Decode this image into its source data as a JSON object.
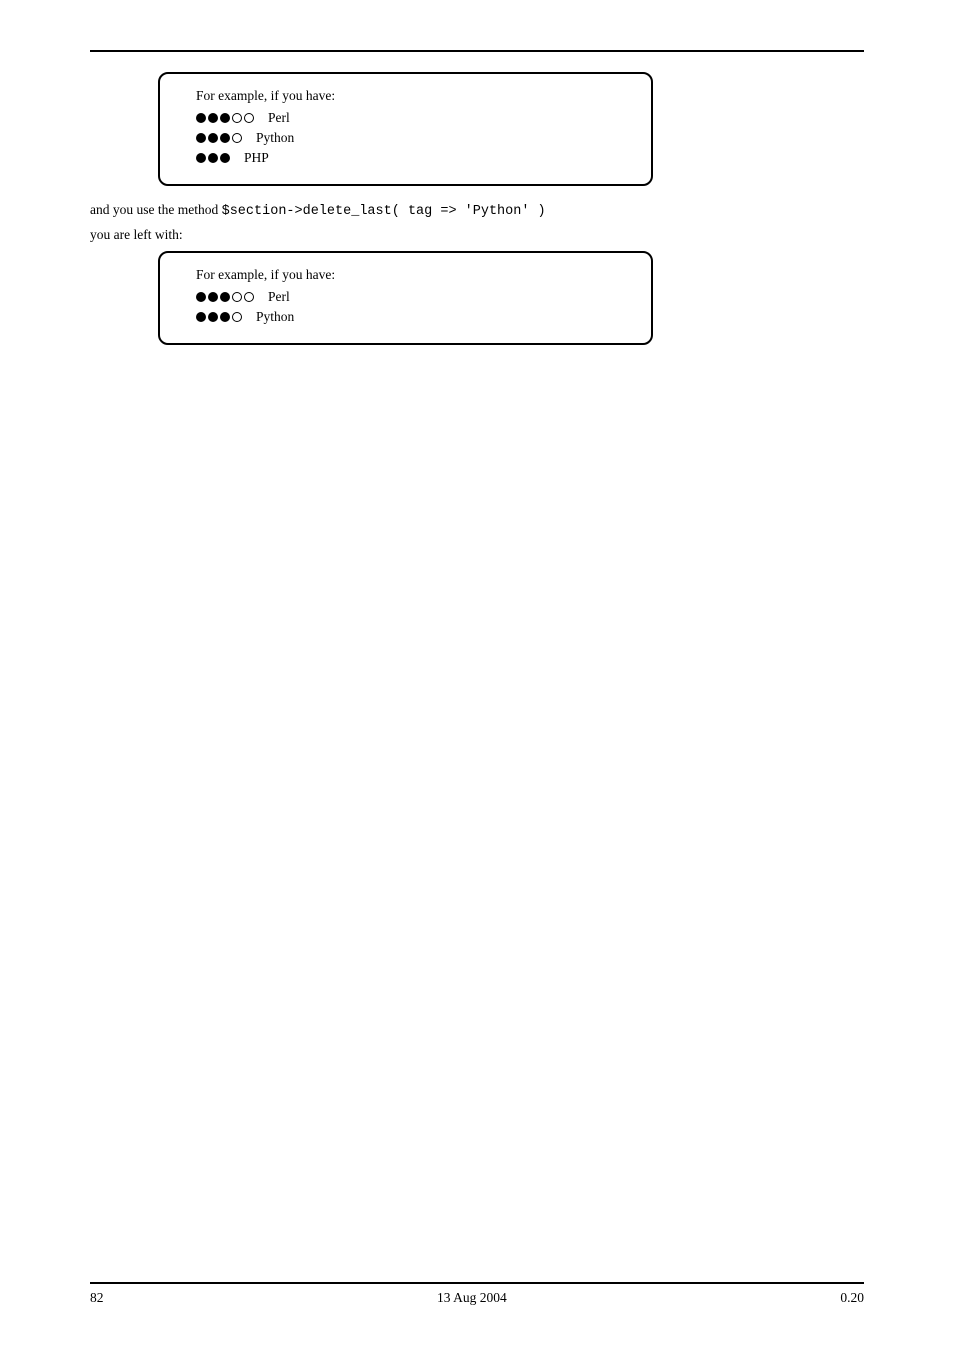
{
  "panel1": {
    "heading": "For example, if you have:",
    "items": [
      {
        "filled": 3,
        "total": 5,
        "text": "Perl"
      },
      {
        "filled": 3,
        "total": 4,
        "text": "Python"
      },
      {
        "filled": 3,
        "total": 3,
        "text": "PHP"
      }
    ]
  },
  "method": {
    "prefix": "and you use the method",
    "cmd": "$section->delete_last( tag => 'Python' )"
  },
  "intermediate": "you are left with:",
  "panel2": {
    "heading": "For example, if you have:",
    "items": [
      {
        "filled": 3,
        "total": 5,
        "text": "Perl"
      },
      {
        "filled": 3,
        "total": 4,
        "text": "Python"
      }
    ]
  },
  "footer": {
    "left": "82",
    "center": "13 Aug 2004",
    "right": "0.20"
  }
}
